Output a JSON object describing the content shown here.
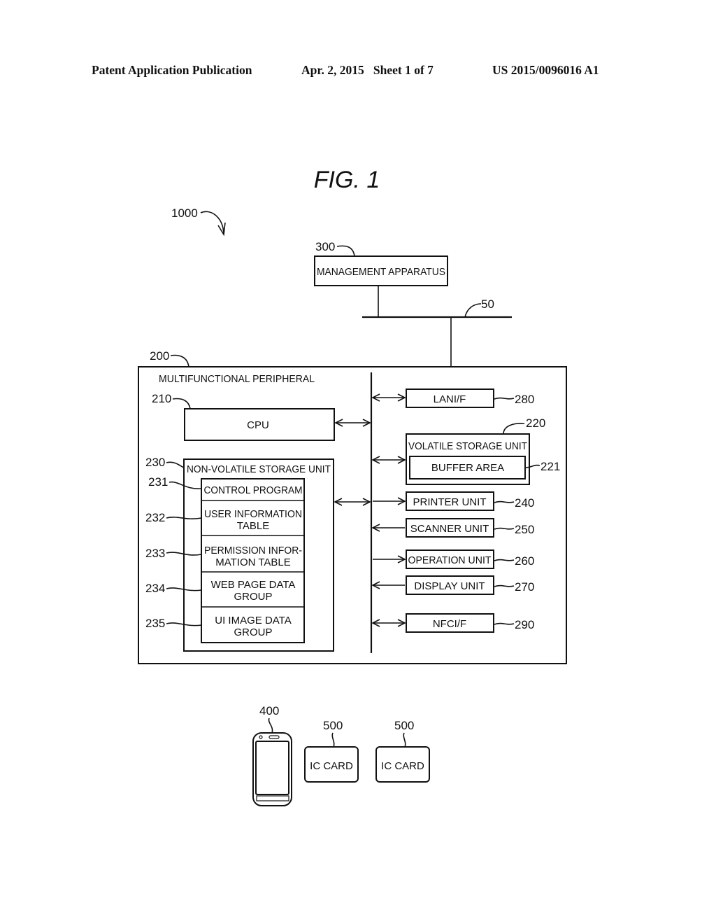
{
  "header": {
    "publication": "Patent Application Publication",
    "date_sheet": "Apr. 2, 2015   Sheet 1 of 7",
    "number": "US 2015/0096016 A1"
  },
  "figure": {
    "title": "FIG. 1",
    "system_ref": "1000",
    "network_ref": "50",
    "management": {
      "ref": "300",
      "label": "MANAGEMENT APPARATUS"
    },
    "mfp": {
      "ref": "200",
      "label": "MULTIFUNCTIONAL PERIPHERAL",
      "cpu": {
        "ref": "210",
        "label": "CPU"
      },
      "nvs": {
        "ref": "230",
        "label": "NON-VOLATILE STORAGE UNIT",
        "items": [
          {
            "ref": "231",
            "line1": "CONTROL PROGRAM",
            "line2": ""
          },
          {
            "ref": "232",
            "line1": "USER INFORMATION",
            "line2": "TABLE"
          },
          {
            "ref": "233",
            "line1": "PERMISSION INFOR-",
            "line2": "MATION TABLE"
          },
          {
            "ref": "234",
            "line1": "WEB PAGE DATA",
            "line2": "GROUP"
          },
          {
            "ref": "235",
            "line1": "UI IMAGE DATA",
            "line2": "GROUP"
          }
        ]
      },
      "lan": {
        "ref": "280",
        "label": "LANI/F"
      },
      "volatile": {
        "ref": "220",
        "label": "VOLATILE STORAGE UNIT",
        "buffer": {
          "ref": "221",
          "label": "BUFFER AREA"
        }
      },
      "units": [
        {
          "ref": "240",
          "label": "PRINTER UNIT",
          "direction": "to-unit"
        },
        {
          "ref": "250",
          "label": "SCANNER UNIT",
          "direction": "to-bus"
        },
        {
          "ref": "260",
          "label": "OPERATION UNIT",
          "direction": "to-unit"
        },
        {
          "ref": "270",
          "label": "DISPLAY UNIT",
          "direction": "to-bus"
        },
        {
          "ref": "290",
          "label": "NFCI/F",
          "direction": "both"
        }
      ]
    },
    "devices": {
      "phone": {
        "ref": "400"
      },
      "cards": [
        {
          "ref": "500",
          "label": "IC CARD"
        },
        {
          "ref": "500",
          "label": "IC CARD"
        }
      ]
    }
  }
}
